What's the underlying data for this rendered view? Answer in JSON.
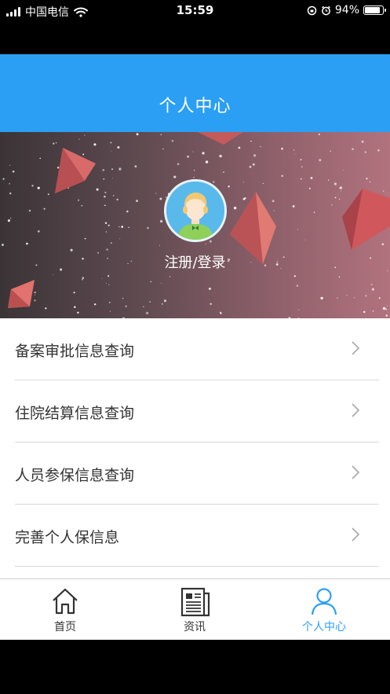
{
  "status_bar": {
    "carrier": "中国电信",
    "time": "15:59",
    "battery": "94%",
    "battery_level": 0.94
  },
  "header": {
    "title": "个人中心"
  },
  "profile": {
    "login_label": "注册/登录"
  },
  "menu": {
    "items": [
      {
        "label": "备案审批信息查询"
      },
      {
        "label": "住院结算信息查询"
      },
      {
        "label": "人员参保信息查询"
      },
      {
        "label": "完善个人保信息"
      }
    ]
  },
  "tabbar": {
    "tabs": [
      {
        "label": "首页",
        "icon": "home-icon"
      },
      {
        "label": "资讯",
        "icon": "news-icon"
      },
      {
        "label": "个人中心",
        "icon": "person-icon",
        "active": true
      }
    ]
  },
  "colors": {
    "accent": "#2a9ff3"
  }
}
